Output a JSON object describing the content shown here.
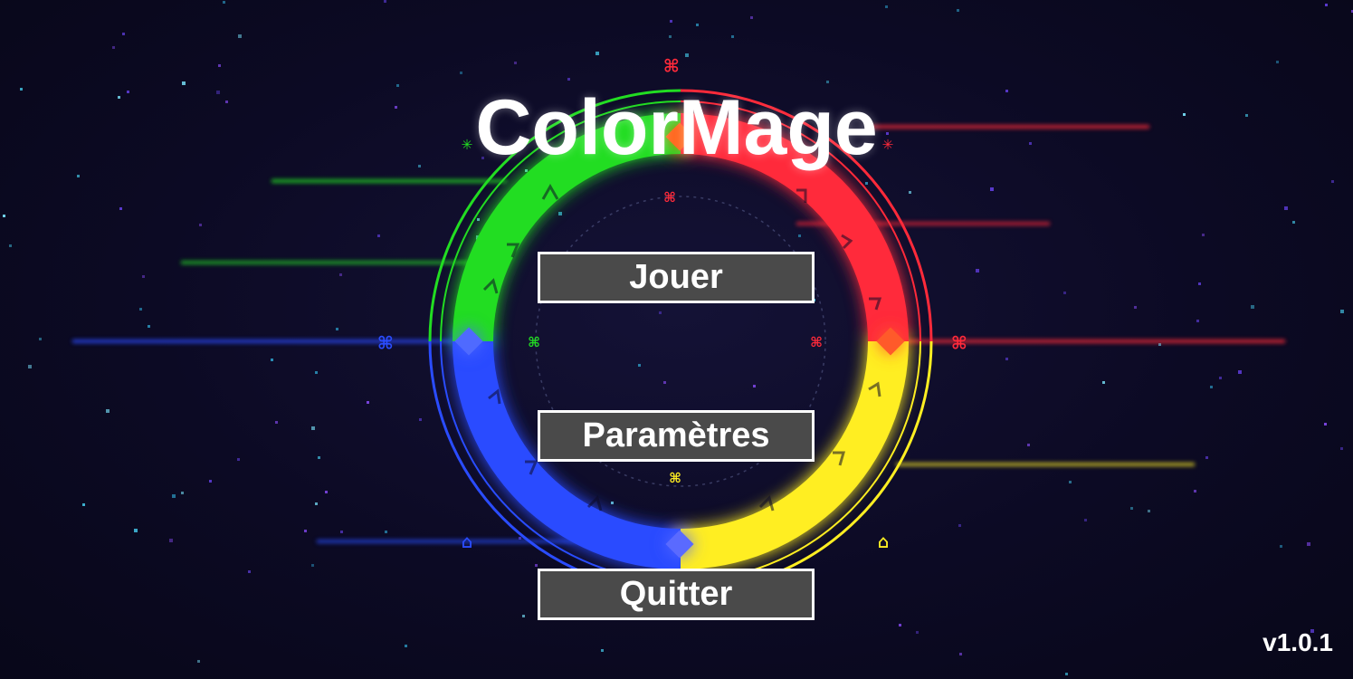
{
  "game": {
    "title": "ColorMage",
    "version": "v1.0.1"
  },
  "menu": {
    "play_label": "Jouer",
    "settings_label": "Paramètres",
    "quit_label": "Quitter"
  },
  "colors": {
    "background": "#0d0b26",
    "ring_green": "#22dd22",
    "ring_red": "#ff2a3a",
    "ring_yellow": "#ffee22",
    "ring_blue": "#2a4cff",
    "button_fill": "#4a4a4a",
    "button_border": "#ffffff"
  },
  "decor": {
    "ring_segments": [
      "green",
      "red",
      "yellow",
      "blue"
    ],
    "icons": [
      "rune-ring-icon",
      "diamond-gem-icon",
      "starfield-background"
    ]
  }
}
